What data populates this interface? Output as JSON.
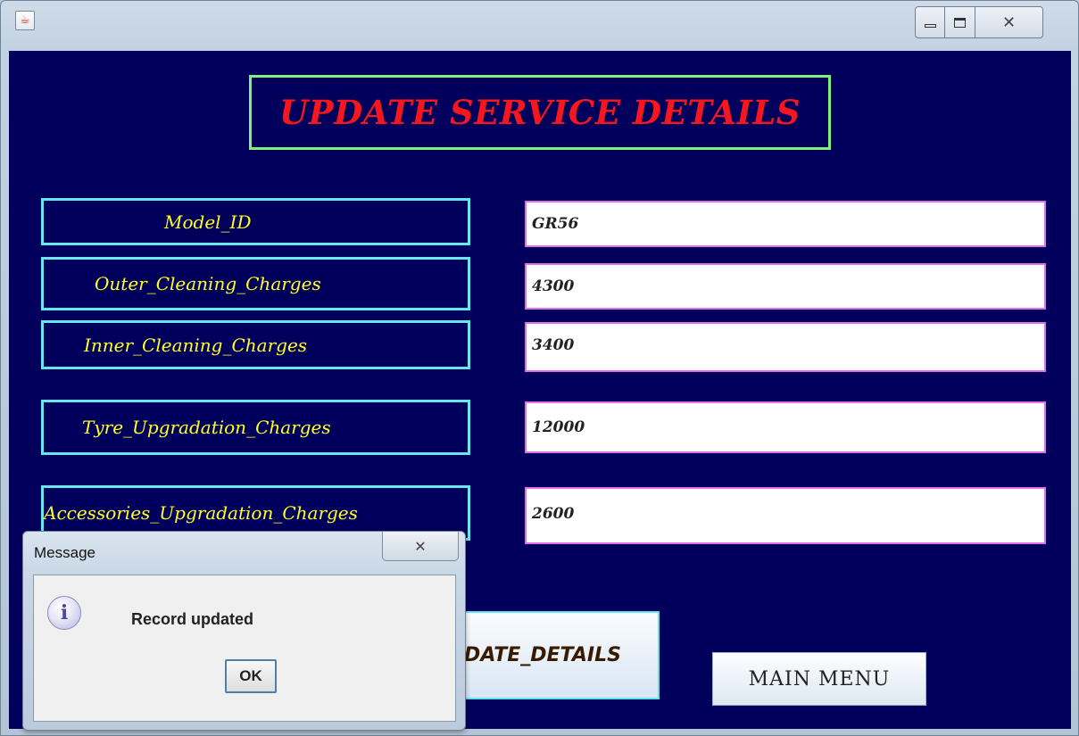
{
  "window": {
    "icon": "java-cup-icon",
    "controls": [
      "minimize-icon",
      "maximize-icon",
      "close-icon"
    ],
    "close_glyph": "☒"
  },
  "form": {
    "heading": "UPDATE SERVICE DETAILS",
    "fields": [
      {
        "label": "Model_ID",
        "value": "GR56"
      },
      {
        "label": "Outer_Cleaning_Charges",
        "value": "4300"
      },
      {
        "label": "Inner_Cleaning_Charges",
        "value": "3400"
      },
      {
        "label": "Tyre_Upgradation_Charges",
        "value": "12000"
      },
      {
        "label": "Accessories_Upgradation_Charges",
        "value": "2600"
      }
    ],
    "update_button": "UPDATE_DETAILS",
    "main_menu_button": "MAIN MENU"
  },
  "dialog": {
    "title": "Message",
    "icon": "info-icon",
    "message": "Record updated",
    "ok_label": "OK"
  },
  "colors": {
    "background": "#00005c",
    "heading_text": "#f5161e",
    "heading_border": "#7cf27c",
    "label_text": "#ffff22",
    "label_border": "#66e6f0",
    "field_border": "#e070e6"
  }
}
